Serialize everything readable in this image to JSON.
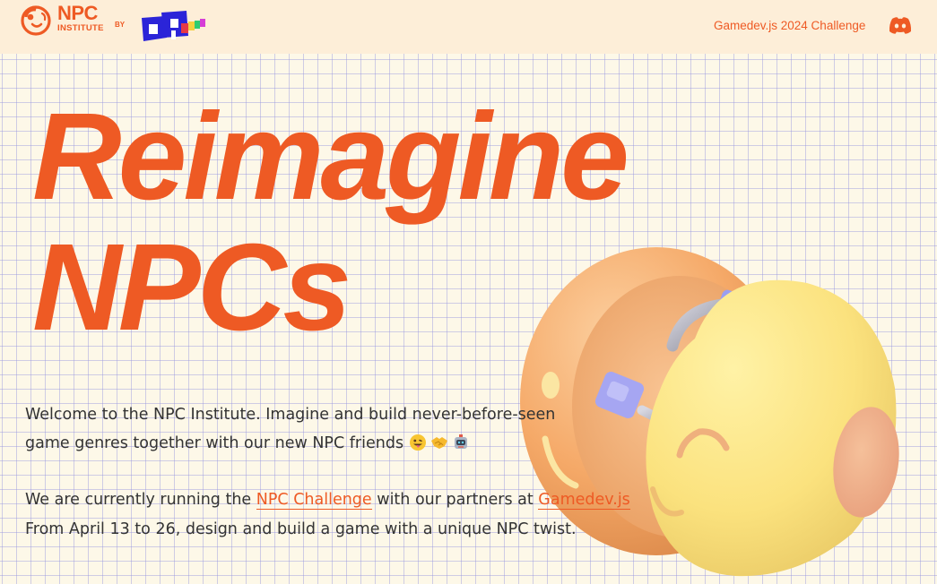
{
  "header": {
    "logo_primary": "NPC",
    "logo_secondary": "INSTITUTE",
    "by_label": "BY",
    "partner_logo": "op-games-logo",
    "nav_link": "Gamedev.js 2024 Challenge",
    "discord_icon": "discord-icon"
  },
  "hero": {
    "line1": "Reimagine",
    "line2": "NPCs"
  },
  "intro": {
    "text": "Welcome to the NPC Institute. Imagine and build never-before-seen game genres together with our new NPC friends",
    "emojis": [
      "grinning-tongue-emoji",
      "handshake-emoji",
      "robot-emoji"
    ]
  },
  "challenge": {
    "before": "We are currently running the ",
    "link1": "NPC Challenge",
    "middle": " with our partners at ",
    "link2": "Gamedev.js",
    "line2": "From April 13 to 26, design and build a game with a unique NPC twist."
  },
  "illustration": "npc-robot-ball-illustration",
  "colors": {
    "accent": "#ee5a24",
    "header_bg": "#fdeed8",
    "page_bg": "#fdf8e8",
    "grid": "#9696e1",
    "body_text": "#333333"
  }
}
